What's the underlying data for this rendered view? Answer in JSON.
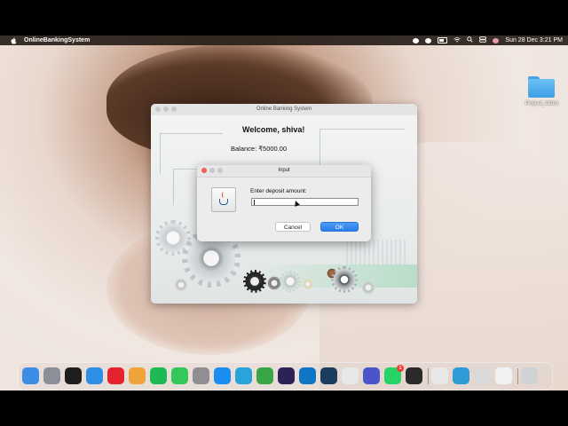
{
  "menubar": {
    "app_name": "OnlineBankingSystem",
    "clock": "Sun 28 Dec  3:21 PM"
  },
  "desktop": {
    "folder_label": "Project_Video"
  },
  "main_window": {
    "title": "Online Banking System",
    "welcome": "Welcome, shiva!",
    "balance": "Balance: ₹5000.00"
  },
  "dialog": {
    "title": "Input",
    "prompt": "Enter deposit amount:",
    "input_value": "",
    "cancel_label": "Cancel",
    "ok_label": "OK"
  },
  "dock": {
    "apps": [
      {
        "name": "finder-icon",
        "color": "#3c8de6"
      },
      {
        "name": "launchpad-icon",
        "color": "#8b8f99"
      },
      {
        "name": "figma-icon",
        "color": "#1e1e1e"
      },
      {
        "name": "safari-icon",
        "color": "#2f8fe6"
      },
      {
        "name": "opera-icon",
        "color": "#e5232f"
      },
      {
        "name": "photos-icon",
        "color": "#f0a33a"
      },
      {
        "name": "spotify-icon",
        "color": "#1db954"
      },
      {
        "name": "facetime-icon",
        "color": "#34c759"
      },
      {
        "name": "settings-icon",
        "color": "#8e8e93"
      },
      {
        "name": "app-store-icon",
        "color": "#1b8cf2"
      },
      {
        "name": "telegram-icon",
        "color": "#2aa3dc"
      },
      {
        "name": "leaf-app-icon",
        "color": "#3aa547"
      },
      {
        "name": "eclipse-icon",
        "color": "#2c2255"
      },
      {
        "name": "vscode-icon",
        "color": "#0f76c6"
      },
      {
        "name": "graph-tool-icon",
        "color": "#1b3c5e"
      },
      {
        "name": "chrome-icon",
        "color": "#e8e8e8"
      },
      {
        "name": "utility-icon",
        "color": "#4a55c9"
      },
      {
        "name": "whatsapp-icon",
        "color": "#25d366"
      },
      {
        "name": "vector-tool-icon",
        "color": "#2a2a2a"
      },
      {
        "name": "chrome-2-icon",
        "color": "#e8e8e8"
      },
      {
        "name": "monitor-app-icon",
        "color": "#2c9bd6"
      },
      {
        "name": "preview-icon",
        "color": "#d9d9d9"
      },
      {
        "name": "java-doc-icon",
        "color": "#f2f2f2"
      },
      {
        "name": "trash-icon",
        "color": "#cfd3d6"
      }
    ],
    "whatsapp_badge": "1"
  }
}
